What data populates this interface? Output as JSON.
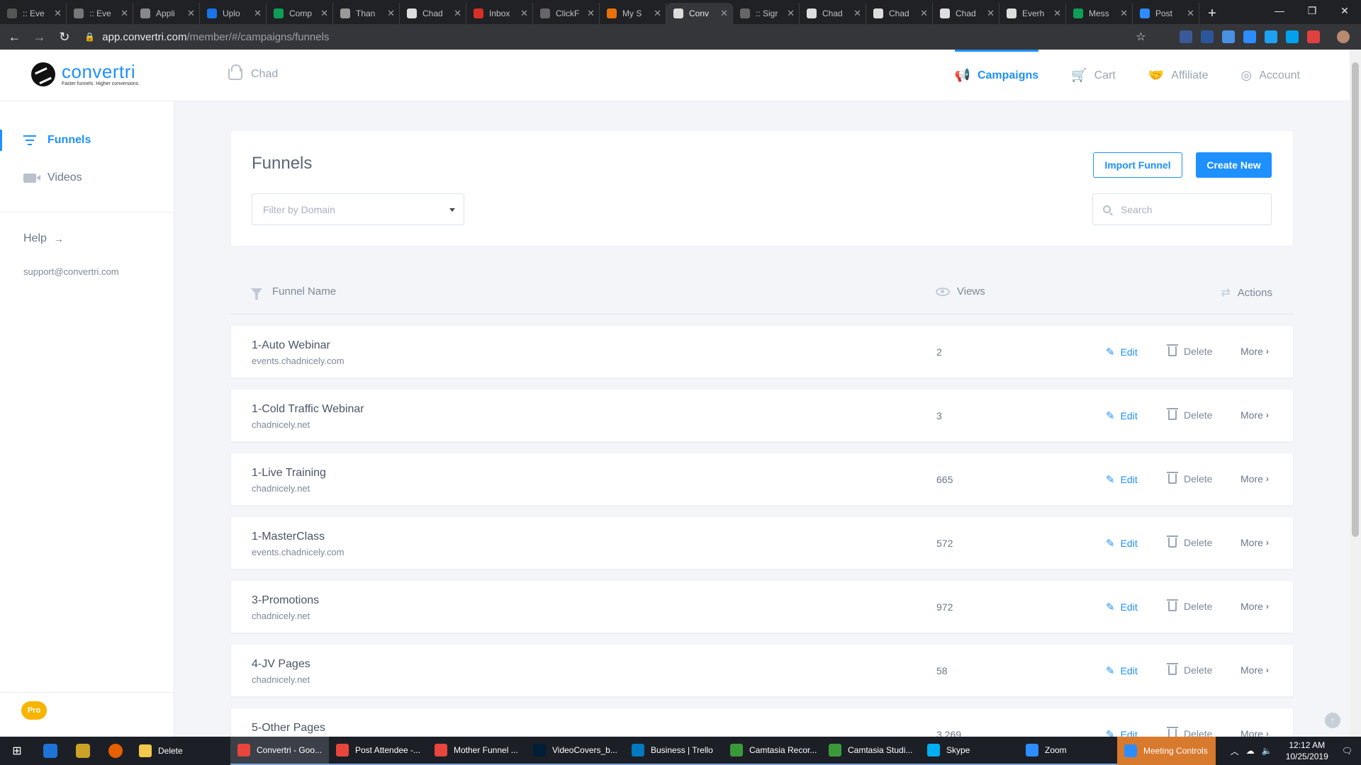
{
  "browser": {
    "tabs": [
      {
        "title": ":: Eve",
        "color": "#555"
      },
      {
        "title": ":: Eve",
        "color": "#777"
      },
      {
        "title": "Appli",
        "color": "#888"
      },
      {
        "title": "Uplo",
        "color": "#1a73e8"
      },
      {
        "title": "Comp",
        "color": "#0f9d58"
      },
      {
        "title": "Than",
        "color": "#999"
      },
      {
        "title": "Chad",
        "color": "#ddd"
      },
      {
        "title": "Inbox",
        "color": "#d93025"
      },
      {
        "title": "ClickF",
        "color": "#666"
      },
      {
        "title": "My S",
        "color": "#e8710a"
      },
      {
        "title": "Conv",
        "color": "#ddd"
      },
      {
        "title": ":: Sigr",
        "color": "#666"
      },
      {
        "title": "Chad",
        "color": "#ddd"
      },
      {
        "title": "Chad",
        "color": "#ddd"
      },
      {
        "title": "Chad",
        "color": "#ddd"
      },
      {
        "title": "Everh",
        "color": "#ddd"
      },
      {
        "title": "Mess",
        "color": "#0f9d58"
      },
      {
        "title": "Post",
        "color": "#2d8cff"
      }
    ],
    "active_tab_index": 10,
    "new_tab": "+",
    "url_host": "app.convertri.com",
    "url_path": "/member/#/campaigns/funnels"
  },
  "header": {
    "logo_word": "convertri",
    "logo_tagline": "Faster funnels. Higher conversions.",
    "workspace": "Chad",
    "nav": [
      {
        "label": "Campaigns",
        "icon": "megaphone-icon",
        "active": true
      },
      {
        "label": "Cart",
        "icon": "cart-icon",
        "active": false
      },
      {
        "label": "Affiliate",
        "icon": "handshake-icon",
        "active": false
      },
      {
        "label": "Account",
        "icon": "user-circle-icon",
        "active": false
      }
    ]
  },
  "sidebar": {
    "items": [
      {
        "label": "Funnels",
        "icon": "filter-icon",
        "active": true
      },
      {
        "label": "Videos",
        "icon": "video-icon",
        "active": false
      }
    ],
    "help_label": "Help",
    "support_email": "support@convertri.com",
    "plan_badge": "Pro"
  },
  "main": {
    "title": "Funnels",
    "import_label": "Import Funnel",
    "create_label": "Create New",
    "filter_placeholder": "Filter by Domain",
    "search_placeholder": "Search",
    "columns": {
      "name": "Funnel Name",
      "views": "Views",
      "actions": "Actions"
    },
    "action_labels": {
      "edit": "Edit",
      "delete": "Delete",
      "more": "More"
    },
    "funnels": [
      {
        "name": "1-Auto Webinar",
        "domain": "events.chadnicely.com",
        "views": "2"
      },
      {
        "name": "1-Cold Traffic Webinar",
        "domain": "chadnicely.net",
        "views": "3"
      },
      {
        "name": "1-Live Training",
        "domain": "chadnicely.net",
        "views": "665"
      },
      {
        "name": "1-MasterClass",
        "domain": "events.chadnicely.com",
        "views": "572"
      },
      {
        "name": "3-Promotions",
        "domain": "chadnicely.net",
        "views": "972"
      },
      {
        "name": "4-JV Pages",
        "domain": "chadnicely.net",
        "views": "58"
      },
      {
        "name": "5-Other Pages",
        "domain": "",
        "views": "3,269"
      }
    ]
  },
  "taskbar": {
    "apps": [
      {
        "label": "Delete",
        "color": "#f2c94c"
      },
      {
        "label": "Convertri - Goo...",
        "color": "#e8453c",
        "focused": true
      },
      {
        "label": "Post Attendee -...",
        "color": "#e8453c"
      },
      {
        "label": "Mother Funnel ...",
        "color": "#e8453c"
      },
      {
        "label": "VideoCovers_b...",
        "color": "#001e36"
      },
      {
        "label": "Business | Trello",
        "color": "#0079bf"
      },
      {
        "label": "Camtasia Recor...",
        "color": "#3a9a3a"
      },
      {
        "label": "Camtasia Studi...",
        "color": "#3a9a3a"
      },
      {
        "label": "Skype",
        "color": "#00aff0"
      },
      {
        "label": "Zoom",
        "color": "#2d8cff"
      },
      {
        "label": "Meeting Controls",
        "color": "#2d8cff",
        "meeting": true
      }
    ],
    "time": "12:12 AM",
    "date": "10/25/2019"
  }
}
